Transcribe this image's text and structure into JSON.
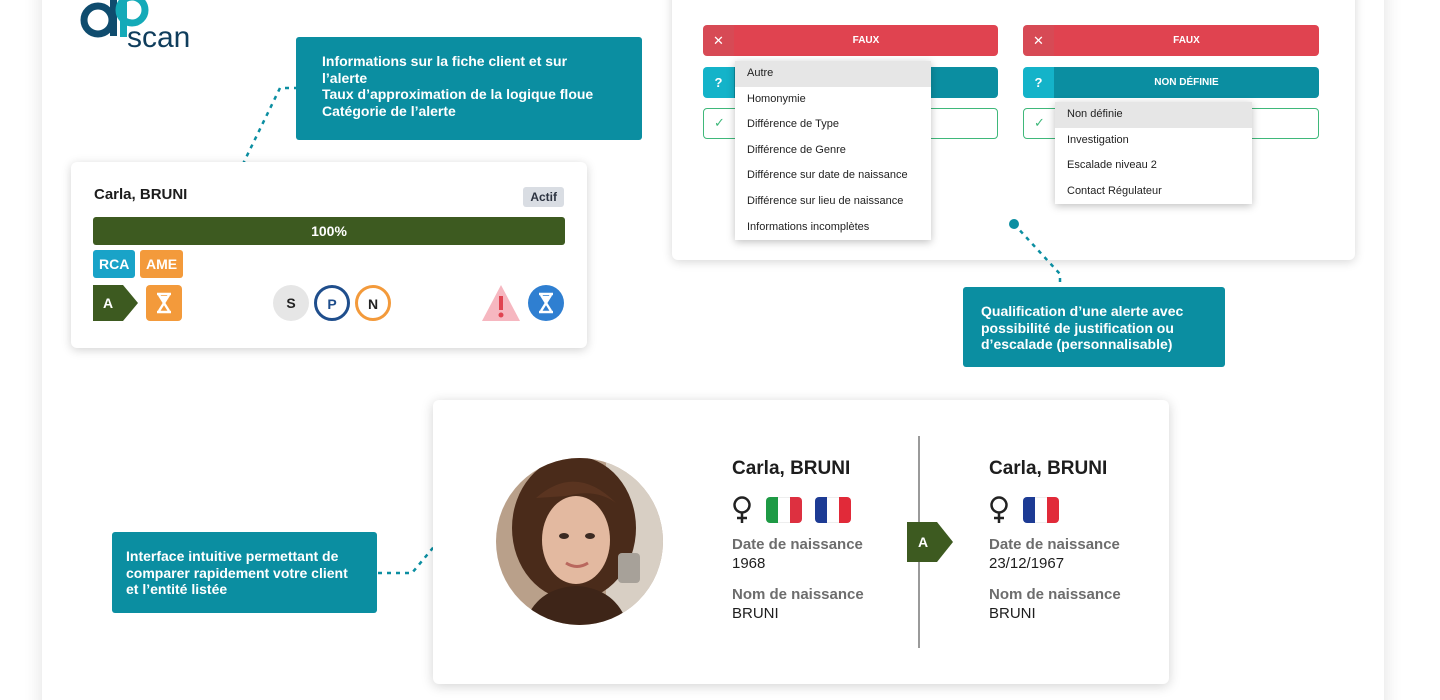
{
  "logo": {
    "text_top": "aP",
    "text_bottom": "scan"
  },
  "callouts": {
    "info": [
      "Informations sur la fiche client et sur",
      "l’alerte",
      "Taux d’approximation de la logique floue",
      "Catégorie de l’alerte"
    ],
    "qualification": [
      "Qualification d’une alerte avec",
      "possibilité de justification ou",
      "d’escalade (personnalisable)"
    ],
    "interface": [
      "Interface intuitive permettant de",
      "comparer rapidement votre client",
      "et l’entité listée"
    ]
  },
  "alert_card": {
    "name": "Carla, BRUNI",
    "status": "Actif",
    "match_percent": 100,
    "match_label": "100%",
    "tags": [
      "RCA",
      "AME"
    ],
    "category": "A",
    "spn": [
      "S",
      "P",
      "N"
    ],
    "colors": {
      "bar": "#3d5a20",
      "rca": "#19a3c8",
      "ame": "#f39a3b",
      "warning": "#e8566a",
      "hourglass": "#2f7fd1"
    }
  },
  "qualification": {
    "left": {
      "false_label": "FAUX",
      "undefined_label": "?",
      "dropdown": [
        "Autre",
        "Homonymie",
        "Différence de Type",
        "Différence de Genre",
        "Différence sur date de naissance",
        "Différence sur lieu de naissance",
        "Informations incomplètes"
      ],
      "selected": "Autre"
    },
    "right": {
      "false_label": "FAUX",
      "undefined_label": "NON DÉFINIE",
      "dropdown": [
        "Non définie",
        "Investigation",
        "Escalade niveau 2",
        "Contact Régulateur"
      ],
      "selected": "Non définie"
    }
  },
  "comparison": {
    "client": {
      "name": "Carla, BRUNI",
      "gender_icon": "female-icon",
      "flags": [
        "italy",
        "france"
      ],
      "birth_label": "Date de naissance",
      "birth_value": "1968",
      "birthname_label": "Nom de naissance",
      "birthname_value": "BRUNI"
    },
    "category": "A",
    "listed": {
      "name": "Carla, BRUNI",
      "gender_icon": "female-icon",
      "flags": [
        "france"
      ],
      "birth_label": "Date de naissance",
      "birth_value": "23/12/1967",
      "birthname_label": "Nom de naissance",
      "birthname_value": "BRUNI"
    }
  }
}
